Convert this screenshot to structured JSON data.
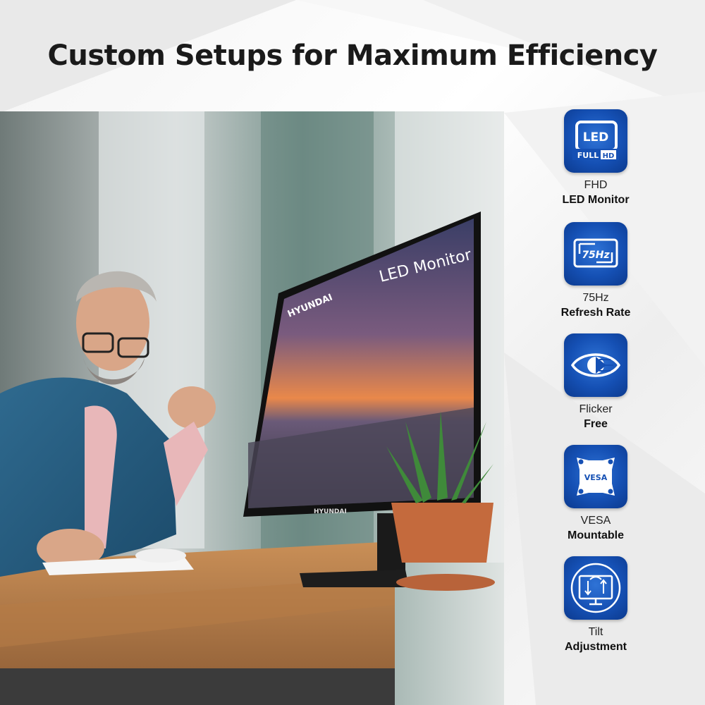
{
  "headline": "Custom Setups for Maximum Efficiency",
  "photo": {
    "monitor_screen_text": "LED Monitor",
    "monitor_brand_top": "HYUNDAI",
    "monitor_brand_bottom": "HYUNDAI"
  },
  "features": [
    {
      "icon": "led-full-hd-icon",
      "badge_top": "LED",
      "badge_bottom_a": "FULL",
      "badge_bottom_b": "HD",
      "line1": "FHD",
      "line2": "LED Monitor"
    },
    {
      "icon": "refresh-rate-75hz-icon",
      "badge_text": "75Hz",
      "line1": "75Hz",
      "line2": "Refresh Rate"
    },
    {
      "icon": "flicker-free-eye-icon",
      "line1": "Flicker",
      "line2": "Free"
    },
    {
      "icon": "vesa-mount-icon",
      "badge_text": "VESA",
      "line1": "VESA",
      "line2": "Mountable"
    },
    {
      "icon": "tilt-adjust-icon",
      "line1": "Tilt",
      "line2": "Adjustment"
    }
  ],
  "colors": {
    "badge_blue": "#1550b4",
    "headline": "#1a1a1a"
  }
}
